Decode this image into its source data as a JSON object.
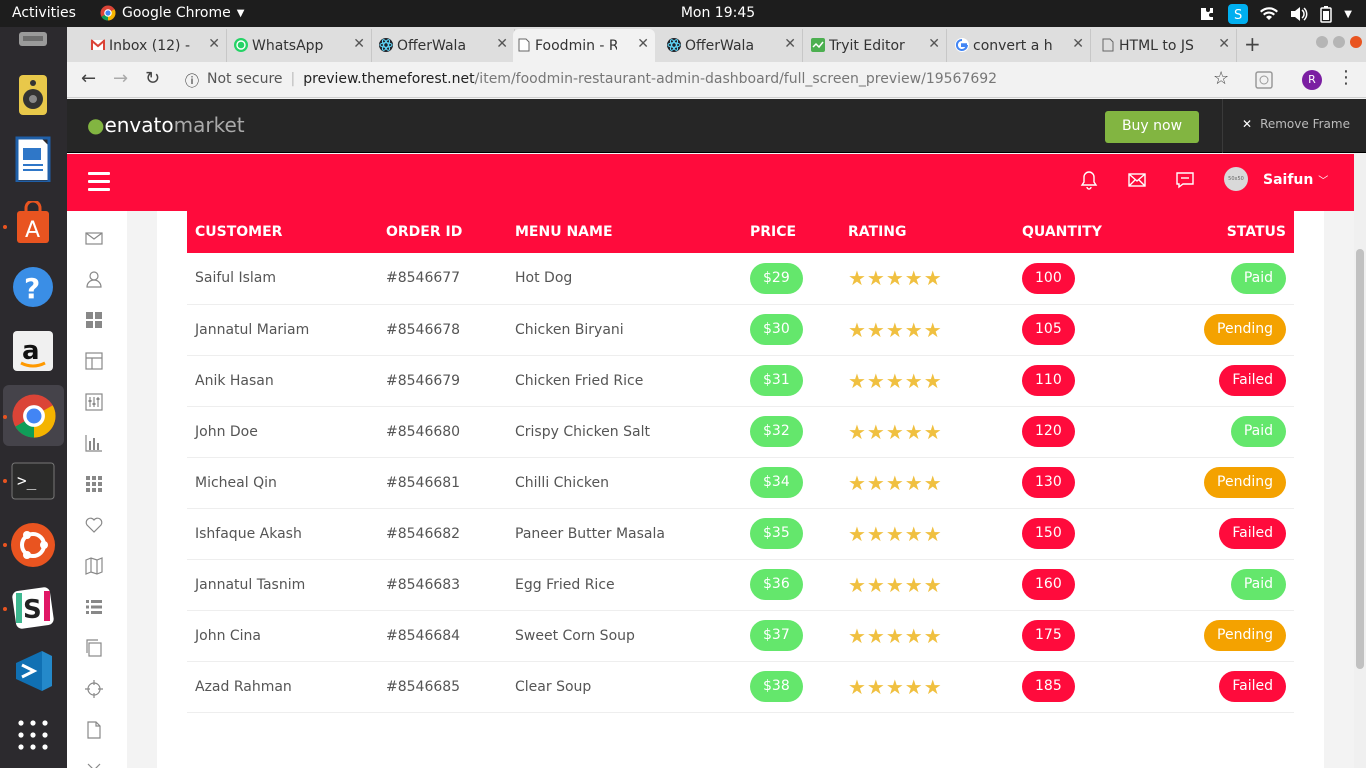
{
  "os": {
    "activities": "Activities",
    "app_name": "Google Chrome",
    "clock": "Mon 19:45"
  },
  "browser": {
    "tabs": [
      {
        "label": "Inbox (12) -",
        "icon": "gmail-icon"
      },
      {
        "label": "WhatsApp",
        "icon": "whatsapp-icon"
      },
      {
        "label": "OfferWala",
        "icon": "react-icon"
      },
      {
        "label": "Foodmin - R",
        "icon": "page-icon",
        "active": true
      },
      {
        "label": "OfferWala",
        "icon": "react-icon"
      },
      {
        "label": "Tryit Editor",
        "icon": "tryit-icon"
      },
      {
        "label": "convert a h",
        "icon": "google-icon"
      },
      {
        "label": "HTML to JS",
        "icon": "page-icon"
      }
    ],
    "security": "Not secure",
    "url_host": "preview.themeforest.net",
    "url_path": "/item/foodmin-restaurant-admin-dashboard/full_screen_preview/19567692",
    "profile_initial": "R"
  },
  "envato": {
    "logo_a": "envato",
    "logo_b": "market",
    "buy_label": "Buy now",
    "remove_label": "Remove Frame"
  },
  "app": {
    "user_name": "Saifun",
    "avatar_text": "50x50"
  },
  "table": {
    "headers": {
      "customer": "CUSTOMER",
      "order_id": "ORDER ID",
      "menu": "MENU NAME",
      "price": "PRICE",
      "rating": "RATING",
      "quantity": "QUANTITY",
      "status": "STATUS"
    },
    "stars": "★★★★★",
    "rows": [
      {
        "customer": "Saiful Islam",
        "order_id": "#8546677",
        "menu": "Hot Dog",
        "price": "$29",
        "quantity": "100",
        "status": "Paid"
      },
      {
        "customer": "Jannatul Mariam",
        "order_id": "#8546678",
        "menu": "Chicken Biryani",
        "price": "$30",
        "quantity": "105",
        "status": "Pending"
      },
      {
        "customer": "Anik Hasan",
        "order_id": "#8546679",
        "menu": "Chicken Fried Rice",
        "price": "$31",
        "quantity": "110",
        "status": "Failed"
      },
      {
        "customer": "John Doe",
        "order_id": "#8546680",
        "menu": "Crispy Chicken Salt",
        "price": "$32",
        "quantity": "120",
        "status": "Paid"
      },
      {
        "customer": "Micheal Qin",
        "order_id": "#8546681",
        "menu": "Chilli Chicken",
        "price": "$34",
        "quantity": "130",
        "status": "Pending"
      },
      {
        "customer": "Ishfaque Akash",
        "order_id": "#8546682",
        "menu": "Paneer Butter Masala",
        "price": "$35",
        "quantity": "150",
        "status": "Failed"
      },
      {
        "customer": "Jannatul Tasnim",
        "order_id": "#8546683",
        "menu": "Egg Fried Rice",
        "price": "$36",
        "quantity": "160",
        "status": "Paid"
      },
      {
        "customer": "John Cina",
        "order_id": "#8546684",
        "menu": "Sweet Corn Soup",
        "price": "$37",
        "quantity": "175",
        "status": "Pending"
      },
      {
        "customer": "Azad Rahman",
        "order_id": "#8546685",
        "menu": "Clear Soup",
        "price": "$38",
        "quantity": "185",
        "status": "Failed"
      }
    ]
  },
  "colors": {
    "brand": "#ff0b3c",
    "price_pill": "#64e76c",
    "quantity_pill": "#ff0b3c",
    "status_paid": "#64e76c",
    "status_pending": "#f4a200",
    "status_failed": "#ff0b3c"
  }
}
